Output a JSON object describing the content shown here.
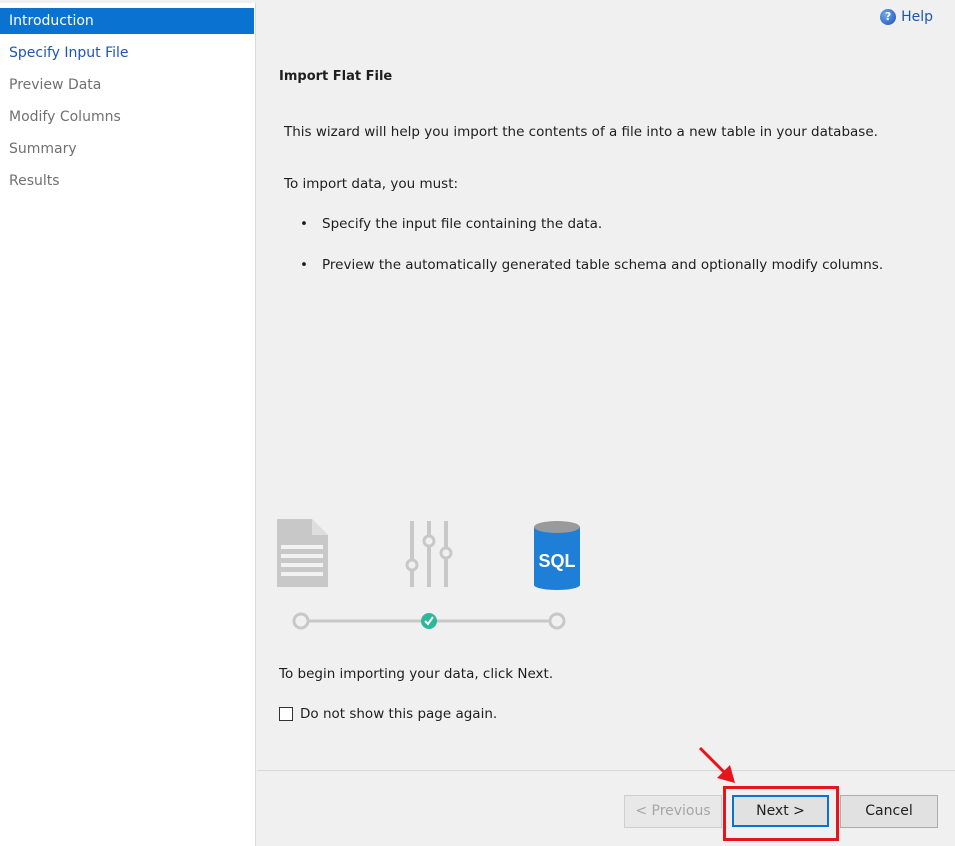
{
  "sidebar": {
    "items": [
      {
        "label": "Introduction",
        "state": "active"
      },
      {
        "label": "Specify Input File",
        "state": "link"
      },
      {
        "label": "Preview Data",
        "state": "disabled"
      },
      {
        "label": "Modify Columns",
        "state": "disabled"
      },
      {
        "label": "Summary",
        "state": "disabled"
      },
      {
        "label": "Results",
        "state": "disabled"
      }
    ]
  },
  "header": {
    "help_label": "Help",
    "help_icon": "help-circle-icon"
  },
  "main": {
    "title": "Import Flat File",
    "intro": "This wizard will help you import the contents of a file into a new table in your database.",
    "must": "To import data, you must:",
    "bullets": [
      "Specify the input file containing the data.",
      "Preview the automatically generated table schema and optionally modify columns."
    ],
    "illustration": {
      "file_icon": "document-icon",
      "settings_icon": "sliders-icon",
      "db_icon": "sql-database-icon",
      "db_label": "SQL",
      "progress_step": 2,
      "progress_steps": 3
    },
    "begin": "To begin importing your data, click Next.",
    "checkbox_label": "Do not show this page again.",
    "checkbox_checked": false
  },
  "footer": {
    "previous_label": "< Previous",
    "next_label": "Next >",
    "cancel_label": "Cancel"
  },
  "colors": {
    "accent": "#0a73d1",
    "link": "#1c56b5",
    "highlight": "#e8141b",
    "check_green": "#2db89a",
    "db_blue": "#1f7ed6"
  }
}
